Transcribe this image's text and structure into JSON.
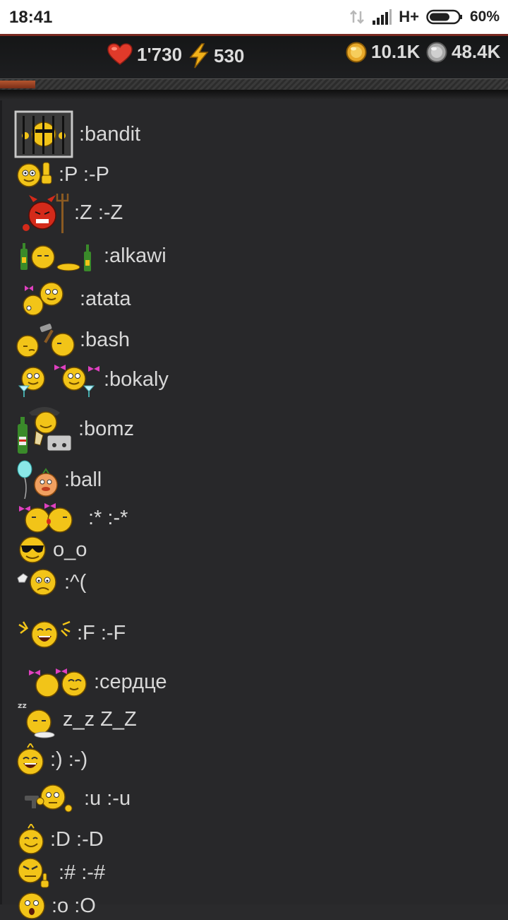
{
  "status_bar": {
    "time": "18:41",
    "network": "H+",
    "battery_percent": "60%"
  },
  "game_bar": {
    "health": "1'730",
    "energy": "530",
    "gold": "10.1K",
    "silver": "48.4K",
    "xp_progress_fraction": 0.07,
    "colors": {
      "health_icon": "#e03a2a",
      "energy_icon": "#f2b21a",
      "gold_icon": "#e8a92a",
      "silver_icon": "#b4b4b4",
      "progress_fill": "#b5562f"
    }
  },
  "emoticons": [
    {
      "code": ":bandit",
      "icon": "bandit-in-jail-icon"
    },
    {
      "code": ":P :-P",
      "icon": "thumbs-up-smiley-icon"
    },
    {
      "code": ":Z :-Z",
      "icon": "devil-with-pitchfork-icon"
    },
    {
      "code": ":alkawi",
      "icon": "drunk-smiley-with-bottles-icon"
    },
    {
      "code": ":atata",
      "icon": "spanking-smileys-icon"
    },
    {
      "code": ":bash",
      "icon": "hammer-bash-smileys-icon"
    },
    {
      "code": ":bokaly",
      "icon": "toasting-smileys-icon"
    },
    {
      "code": ":bomz",
      "icon": "homeless-smiley-icon"
    },
    {
      "code": ":ball",
      "icon": "smiley-with-balloon-icon"
    },
    {
      "code": ":* :-*",
      "icon": "kissing-smileys-icon"
    },
    {
      "code": "o_o",
      "icon": "sunglasses-smiley-icon"
    },
    {
      "code": ":^(",
      "icon": "sad-thinking-smiley-icon"
    },
    {
      "code": ":F :-F",
      "icon": "laughing-smiley-icon"
    },
    {
      "code": ":сердце",
      "icon": "loving-smileys-icon"
    },
    {
      "code": "z_z Z_Z",
      "icon": "sleeping-smiley-icon"
    },
    {
      "code": ":) :-)",
      "icon": "happy-smiley-icon"
    },
    {
      "code": ":u :-u",
      "icon": "smiley-with-gun-icon"
    },
    {
      "code": ":D :-D",
      "icon": "grinning-smiley-icon"
    },
    {
      "code": ":# :-#",
      "icon": "angry-finger-smiley-icon"
    },
    {
      "code": ":o :O",
      "icon": "surprised-smiley-icon"
    }
  ]
}
